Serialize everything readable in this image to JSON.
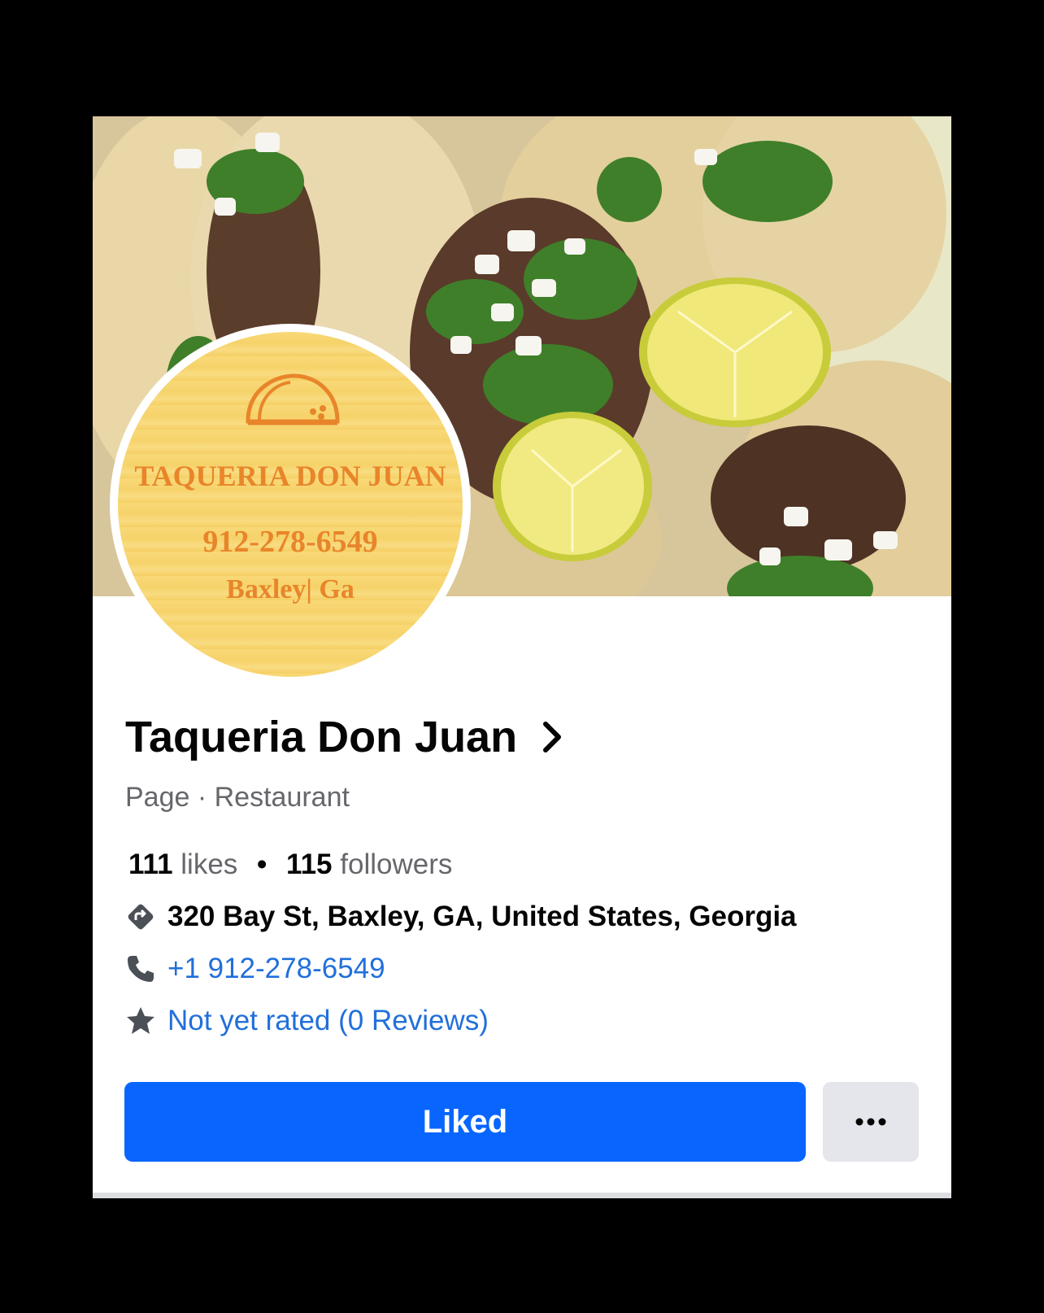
{
  "logo": {
    "name": "TAQUERIA DON JUAN",
    "phone": "912-278-6549",
    "city": "Baxley| Ga"
  },
  "page": {
    "title": "Taqueria Don Juan",
    "subtitle": "Page · Restaurant"
  },
  "stats": {
    "likes_count": "111",
    "likes_label": "likes",
    "separator": "•",
    "followers_count": "115",
    "followers_label": "followers"
  },
  "info": {
    "address": "320 Bay St, Baxley, GA, United States, Georgia",
    "phone": "+1 912-278-6549",
    "rating": "Not yet rated (0 Reviews)"
  },
  "actions": {
    "liked_label": "Liked",
    "more_label": "..."
  },
  "icons": {
    "title_chevron": "chevron-right-icon",
    "address": "directions-icon",
    "phone": "phone-icon",
    "rating": "star-icon",
    "more": "more-icon",
    "logo": "taco-icon"
  },
  "colors": {
    "primary": "#0866ff",
    "link": "#216fdb",
    "secondary_text": "#65676b",
    "logo_text": "#e8852a"
  }
}
